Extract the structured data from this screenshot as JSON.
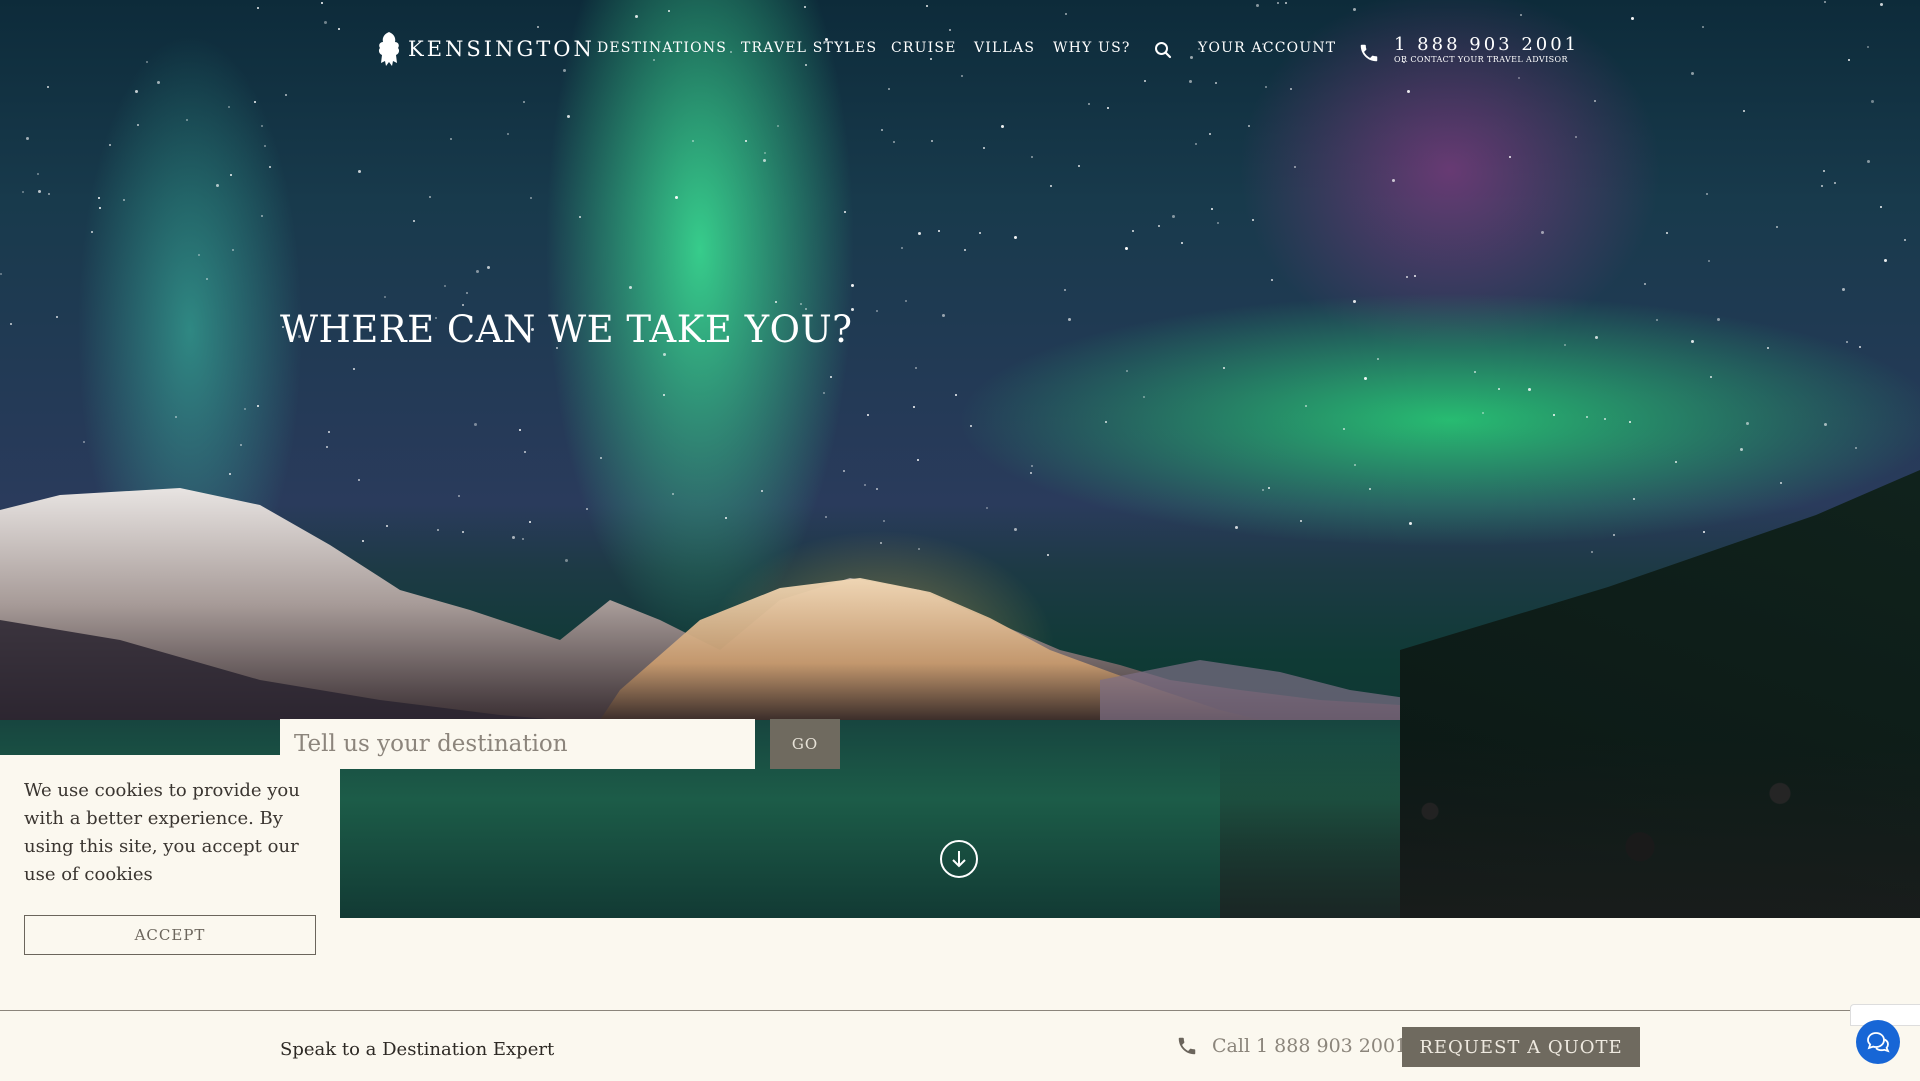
{
  "brand": {
    "name": "KENSINGTON",
    "logo_icon": "griffin-logo-icon"
  },
  "nav": {
    "links": [
      "DESTINATIONS",
      "TRAVEL STYLES",
      "CRUISE",
      "VILLAS",
      "WHY US?"
    ],
    "search_icon": "search-icon",
    "account": "YOUR ACCOUNT",
    "phone": "1 888 903 2001",
    "phone_sub": "OR CONTACT YOUR TRAVEL ADVISOR"
  },
  "hero": {
    "headline": "WHERE CAN WE TAKE YOU?",
    "search_placeholder": "Tell us your destination",
    "go_label": "GO",
    "scroll_icon": "arrow-down-circle-icon"
  },
  "cookie": {
    "text": "We use cookies to provide you with a better experience. By using this site, you accept our use of cookies",
    "accept_label": "ACCEPT"
  },
  "footer_bar": {
    "speak": "Speak to a Destination Expert",
    "call": "Call 1 888 903 2001",
    "quote_label": "REQUEST A QUOTE",
    "chat_icon": "chat-bubbles-icon"
  },
  "colors": {
    "cream": "#fbf8ef",
    "button_taupe": "#6f6a5f",
    "chat_blue": "#1766d6"
  }
}
